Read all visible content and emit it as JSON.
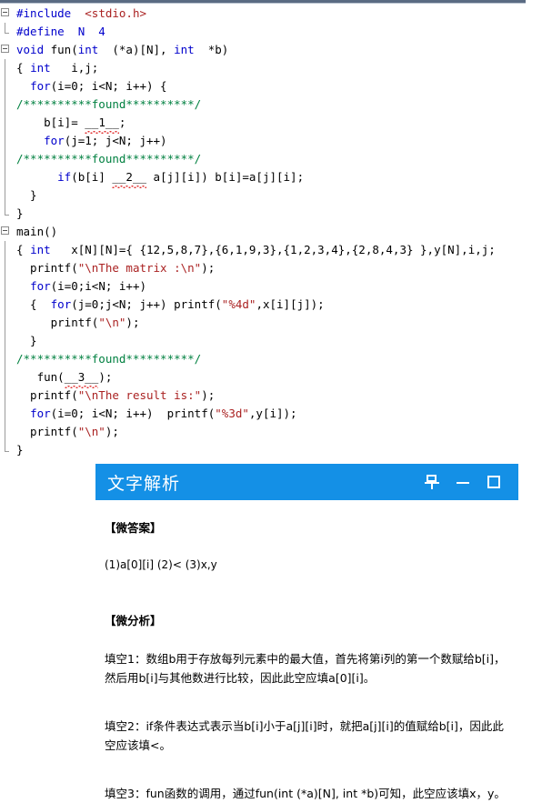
{
  "editor": {
    "name": "c-source-editor",
    "language": "C",
    "lines": [
      {
        "fold": "open",
        "gutter": "none",
        "indent": 0,
        "tokens": [
          {
            "t": "#include ",
            "c": "pre"
          },
          {
            "t": " ",
            "c": "plain"
          },
          {
            "t": "<stdio.h>",
            "c": "str"
          }
        ]
      },
      {
        "fold": "none",
        "gutter": "end",
        "indent": 0,
        "tokens": [
          {
            "t": "#define  N  4",
            "c": "pre"
          }
        ]
      },
      {
        "fold": "open",
        "gutter": "none",
        "indent": 0,
        "tokens": [
          {
            "t": "void",
            "c": "kw"
          },
          {
            "t": " fun(",
            "c": "plain"
          },
          {
            "t": "int",
            "c": "kw"
          },
          {
            "t": "  (*a)[N], ",
            "c": "plain"
          },
          {
            "t": "int",
            "c": "kw"
          },
          {
            "t": "  *b)",
            "c": "plain"
          }
        ]
      },
      {
        "fold": "none",
        "gutter": "line",
        "indent": 0,
        "tokens": [
          {
            "t": "{ ",
            "c": "plain"
          },
          {
            "t": "int",
            "c": "kw"
          },
          {
            "t": "   i,j;",
            "c": "plain"
          }
        ]
      },
      {
        "fold": "none",
        "gutter": "line",
        "indent": 0,
        "tokens": [
          {
            "t": "  ",
            "c": "plain"
          },
          {
            "t": "for",
            "c": "kw"
          },
          {
            "t": "(i=0; i<N; i++) {",
            "c": "plain"
          }
        ]
      },
      {
        "fold": "none",
        "gutter": "line",
        "indent": 0,
        "tokens": [
          {
            "t": "/**********found**********/",
            "c": "cmt"
          }
        ]
      },
      {
        "fold": "none",
        "gutter": "line",
        "indent": 0,
        "tokens": [
          {
            "t": "    b[i]= ",
            "c": "plain"
          },
          {
            "t": "__1__",
            "c": "plain",
            "squiggle": true
          },
          {
            "t": ";",
            "c": "plain"
          }
        ]
      },
      {
        "fold": "none",
        "gutter": "line",
        "indent": 0,
        "tokens": [
          {
            "t": "    ",
            "c": "plain"
          },
          {
            "t": "for",
            "c": "kw"
          },
          {
            "t": "(j=1; j<N; j++)",
            "c": "plain"
          }
        ]
      },
      {
        "fold": "none",
        "gutter": "line",
        "indent": 0,
        "tokens": [
          {
            "t": "/**********found**********/",
            "c": "cmt"
          }
        ]
      },
      {
        "fold": "none",
        "gutter": "line",
        "indent": 0,
        "tokens": [
          {
            "t": "      ",
            "c": "plain"
          },
          {
            "t": "if",
            "c": "kw"
          },
          {
            "t": "(b[i] ",
            "c": "plain"
          },
          {
            "t": "__2__",
            "c": "plain",
            "squiggle": true
          },
          {
            "t": " a[j][i]) b[i]=a[j][i];",
            "c": "plain"
          }
        ]
      },
      {
        "fold": "none",
        "gutter": "line",
        "indent": 0,
        "tokens": [
          {
            "t": "  }",
            "c": "plain"
          }
        ]
      },
      {
        "fold": "none",
        "gutter": "end",
        "indent": 0,
        "tokens": [
          {
            "t": "}",
            "c": "plain"
          }
        ]
      },
      {
        "fold": "open",
        "gutter": "none",
        "indent": 0,
        "tokens": [
          {
            "t": "main()",
            "c": "plain"
          }
        ]
      },
      {
        "fold": "none",
        "gutter": "line",
        "indent": 0,
        "tokens": [
          {
            "t": "{ ",
            "c": "plain"
          },
          {
            "t": "int",
            "c": "kw"
          },
          {
            "t": "   x[N][N]={ {12,5,8,7},{6,1,9,3},{1,2,3,4},{2,8,4,3} },y[N],i,j;",
            "c": "plain"
          }
        ]
      },
      {
        "fold": "none",
        "gutter": "line",
        "indent": 0,
        "tokens": [
          {
            "t": "  printf(",
            "c": "plain"
          },
          {
            "t": "\"\\nThe matrix :\\n\"",
            "c": "str"
          },
          {
            "t": ");",
            "c": "plain"
          }
        ]
      },
      {
        "fold": "none",
        "gutter": "line",
        "indent": 0,
        "tokens": [
          {
            "t": "  ",
            "c": "plain"
          },
          {
            "t": "for",
            "c": "kw"
          },
          {
            "t": "(i=0;i<N; i++)",
            "c": "plain"
          }
        ]
      },
      {
        "fold": "none",
        "gutter": "line",
        "indent": 0,
        "tokens": [
          {
            "t": "  {  ",
            "c": "plain"
          },
          {
            "t": "for",
            "c": "kw"
          },
          {
            "t": "(j=0;j<N; j++) printf(",
            "c": "plain"
          },
          {
            "t": "\"%4d\"",
            "c": "str"
          },
          {
            "t": ",x[i][j]);",
            "c": "plain"
          }
        ]
      },
      {
        "fold": "none",
        "gutter": "line",
        "indent": 0,
        "tokens": [
          {
            "t": "     printf(",
            "c": "plain"
          },
          {
            "t": "\"\\n\"",
            "c": "str"
          },
          {
            "t": ");",
            "c": "plain"
          }
        ]
      },
      {
        "fold": "none",
        "gutter": "line",
        "indent": 0,
        "tokens": [
          {
            "t": "  }",
            "c": "plain"
          }
        ]
      },
      {
        "fold": "none",
        "gutter": "line",
        "indent": 0,
        "tokens": [
          {
            "t": "/**********found**********/",
            "c": "cmt"
          }
        ]
      },
      {
        "fold": "none",
        "gutter": "line",
        "indent": 0,
        "tokens": [
          {
            "t": "   fun(",
            "c": "plain"
          },
          {
            "t": "__3__",
            "c": "plain",
            "squiggle": true
          },
          {
            "t": ");",
            "c": "plain"
          }
        ]
      },
      {
        "fold": "none",
        "gutter": "line",
        "indent": 0,
        "tokens": [
          {
            "t": "  printf(",
            "c": "plain"
          },
          {
            "t": "\"\\nThe result is:\"",
            "c": "str"
          },
          {
            "t": ");",
            "c": "plain"
          }
        ]
      },
      {
        "fold": "none",
        "gutter": "line",
        "indent": 0,
        "tokens": [
          {
            "t": "  ",
            "c": "plain"
          },
          {
            "t": "for",
            "c": "kw"
          },
          {
            "t": "(i=0; i<N; i++)  printf(",
            "c": "plain"
          },
          {
            "t": "\"%3d\"",
            "c": "str"
          },
          {
            "t": ",y[i]);",
            "c": "plain"
          }
        ]
      },
      {
        "fold": "none",
        "gutter": "line",
        "indent": 0,
        "tokens": [
          {
            "t": "  printf(",
            "c": "plain"
          },
          {
            "t": "\"\\n\"",
            "c": "str"
          },
          {
            "t": ");",
            "c": "plain"
          }
        ]
      },
      {
        "fold": "none",
        "gutter": "end",
        "indent": 0,
        "tokens": [
          {
            "t": "}",
            "c": "plain"
          }
        ]
      }
    ]
  },
  "panel": {
    "title": "文字解析",
    "titlebar_color": "#1490e6",
    "actions": [
      {
        "name": "pin-icon",
        "label": "自动隐藏"
      },
      {
        "name": "minimize-icon",
        "label": "最小化"
      },
      {
        "name": "maximize-icon",
        "label": "最大化"
      }
    ],
    "answer_section": {
      "heading": "【微答案】",
      "text": "(1)a[0][i] (2)< (3)x,y"
    },
    "analysis_section": {
      "heading": "【微分析】",
      "paragraphs": [
        "填空1：数组b用于存放每列元素中的最大值，首先将第i列的第一个数赋给b[i]，然后用b[i]与其他数进行比较，因此此空应填a[0][i]。",
        "填空2：if条件表达式表示当b[i]小于a[j][i]时，就把a[j][i]的值赋给b[i]，因此此空应该填<。",
        "填空3：fun函数的调用，通过fun(int (*a)[N], int *b)可知，此空应该填x，y。"
      ]
    }
  }
}
